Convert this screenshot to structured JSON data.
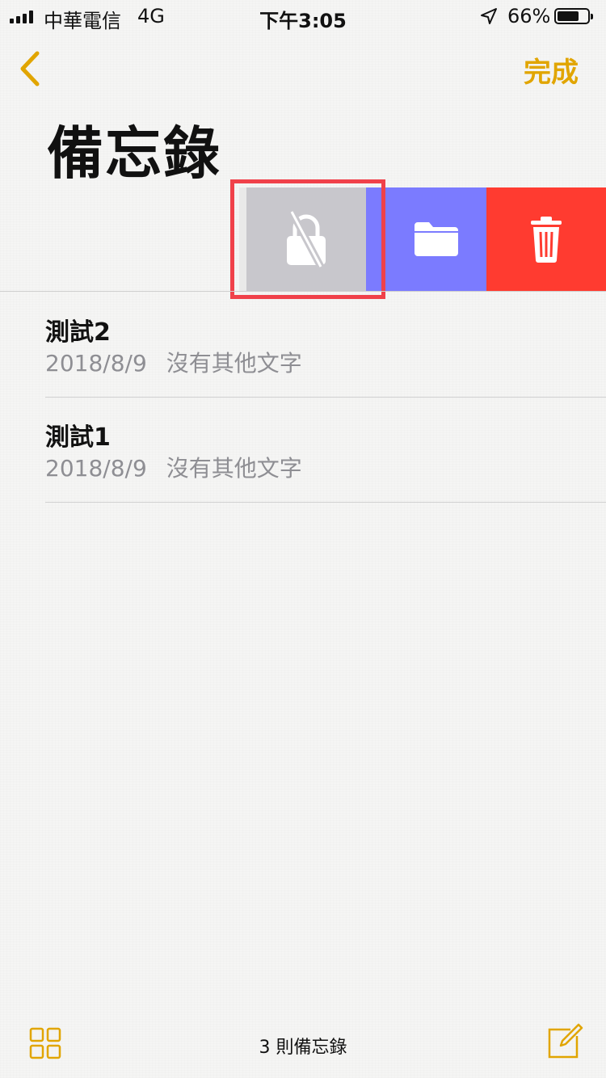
{
  "status_bar": {
    "carrier": "中華電信",
    "network": "4G",
    "time": "下午3:05",
    "battery": "66%",
    "battery_level": 0.66
  },
  "nav": {
    "done_label": "完成",
    "title": "備忘錄"
  },
  "swipe_actions": [
    {
      "name": "unlock",
      "icon": "lock-slash-icon",
      "color": "#c8c7cc"
    },
    {
      "name": "move",
      "icon": "folder-icon",
      "color": "#7b7bff"
    },
    {
      "name": "delete",
      "icon": "trash-icon",
      "color": "#ff3b30"
    }
  ],
  "notes": [
    {
      "title": "測試2",
      "date": "2018/8/9",
      "preview": "沒有其他文字"
    },
    {
      "title": "測試1",
      "date": "2018/8/9",
      "preview": "沒有其他文字"
    }
  ],
  "toolbar": {
    "count_label": "3 則備忘錄"
  },
  "colors": {
    "accent": "#e1a500",
    "highlight": "#f0414a",
    "delete": "#ff3b30",
    "folder": "#7b7bff",
    "lock": "#c8c7cc"
  }
}
